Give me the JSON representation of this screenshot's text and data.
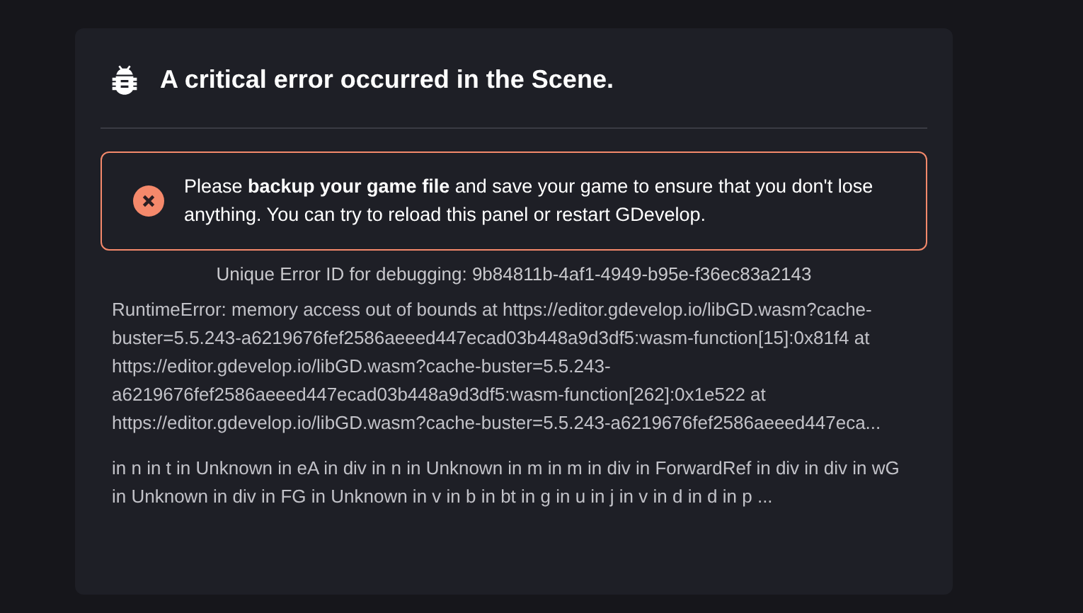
{
  "dialog": {
    "title": "A critical error occurred in the Scene.",
    "alert": {
      "kind": "error",
      "message": "Please **backup your game file** and save your game to ensure that you don't lose anything. You can try to reload this panel or restart GDevelop."
    },
    "error_id": "Unique Error ID for debugging: 9b84811b-4af1-4949-b95e-f36ec83a2143",
    "error_message": "RuntimeError: memory access out of bounds at https://editor.gdevelop.io/libGD.wasm?cache-buster=5.5.243-a6219676fef2586aeeed447ecad03b448a9d3df5:wasm-function[15]:0x81f4 at https://editor.gdevelop.io/libGD.wasm?cache-buster=5.5.243-a6219676fef2586aeeed447ecad03b448a9d3df5:wasm-function[262]:0x1e522 at https://editor.gdevelop.io/libGD.wasm?cache-buster=5.5.243-a6219676fef2586aeeed447eca...",
    "component_stack": "in n in t in Unknown in eA in div in n in Unknown in m in m in div in ForwardRef in div in div in wG in Unknown in div in FG in Unknown in v in b in bt in g in u in j in v in d in d in p ..."
  }
}
